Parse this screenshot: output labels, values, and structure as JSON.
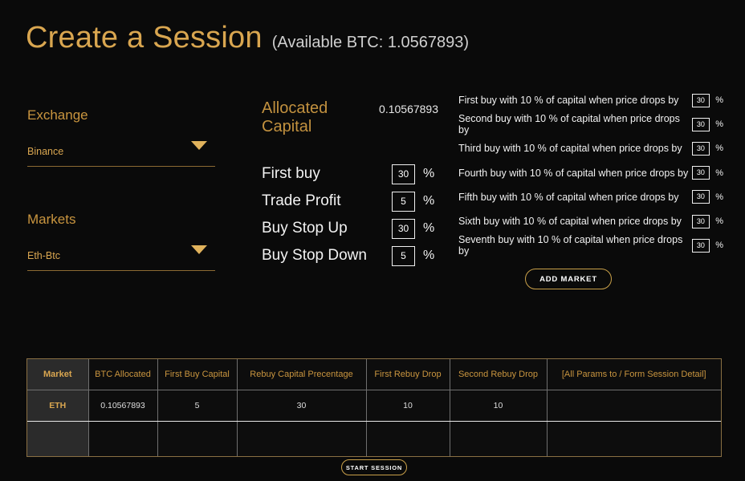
{
  "header": {
    "title": "Create a Session",
    "available_btc": "(Available BTC: 1.0567893)"
  },
  "left": {
    "exchange_label": "Exchange",
    "exchange_value": "Binance",
    "markets_label": "Markets",
    "markets_value": "Eth-Btc"
  },
  "middle": {
    "allocated_capital_label": "Allocated Capital",
    "allocated_capital_value": "0.10567893",
    "pct_symbol": "%",
    "rows": [
      {
        "label": "First buy",
        "value": "30"
      },
      {
        "label": "Trade Profit",
        "value": "5"
      },
      {
        "label": "Buy Stop Up",
        "value": "30"
      },
      {
        "label": "Buy Stop Down",
        "value": "5"
      }
    ]
  },
  "right": {
    "pct_symbol": "%",
    "rows": [
      {
        "text": "First buy with 10 % of capital when price drops by",
        "value": "30"
      },
      {
        "text": "Second buy with 10 % of capital when price drops by",
        "value": "30"
      },
      {
        "text": "Third buy with 10 % of capital when price drops by",
        "value": "30"
      },
      {
        "text": "Fourth buy with 10 % of capital when price drops by",
        "value": "30"
      },
      {
        "text": "Fifth buy with 10 % of capital when price drops by",
        "value": "30"
      },
      {
        "text": "Sixth buy with 10 % of capital when price drops by",
        "value": "30"
      },
      {
        "text": "Seventh buy with 10 % of capital when price drops by",
        "value": "30"
      }
    ],
    "add_market_label": "ADD MARKET"
  },
  "table": {
    "headers": [
      "Market",
      "BTC Allocated",
      "First Buy Capital",
      "Rebuy Capital Precentage",
      "First Rebuy Drop",
      "Second Rebuy Drop",
      "[All Params to / Form Session Detail]"
    ],
    "rows": [
      [
        "ETH",
        "0.10567893",
        "5",
        "30",
        "10",
        "10",
        ""
      ],
      [
        "",
        "",
        "",
        "",
        "",
        "",
        ""
      ]
    ]
  },
  "footer": {
    "start_session_label": "START SESSION"
  },
  "colors": {
    "background": "#0a0a0a",
    "gold": "#d9a650",
    "gold_dim": "#c9953f",
    "text": "#f2f2f2",
    "border_gold": "#8a7043"
  }
}
